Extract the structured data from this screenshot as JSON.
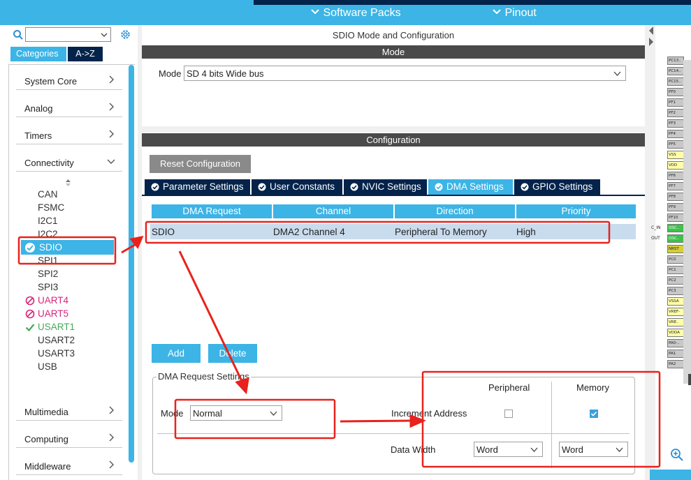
{
  "topbar": {
    "software_packs": "Software Packs",
    "pinout": "Pinout"
  },
  "left": {
    "tab_categories": "Categories",
    "tab_az": "A->Z",
    "categories": {
      "system_core": "System Core",
      "analog": "Analog",
      "timers": "Timers",
      "connectivity": "Connectivity",
      "multimedia": "Multimedia",
      "computing": "Computing",
      "middleware": "Middleware"
    },
    "peripherals": [
      {
        "label": "CAN",
        "status": "none"
      },
      {
        "label": "FSMC",
        "status": "none"
      },
      {
        "label": "I2C1",
        "status": "none"
      },
      {
        "label": "I2C2",
        "status": "none"
      },
      {
        "label": "SDIO",
        "status": "selected"
      },
      {
        "label": "SPI1",
        "status": "none"
      },
      {
        "label": "SPI2",
        "status": "none"
      },
      {
        "label": "SPI3",
        "status": "none"
      },
      {
        "label": "UART4",
        "status": "error"
      },
      {
        "label": "UART5",
        "status": "error"
      },
      {
        "label": "USART1",
        "status": "ok"
      },
      {
        "label": "USART2",
        "status": "none"
      },
      {
        "label": "USART3",
        "status": "none"
      },
      {
        "label": "USB",
        "status": "none"
      }
    ]
  },
  "center": {
    "title": "SDIO Mode and Configuration",
    "mode_bar": "Mode",
    "mode_label": "Mode",
    "mode_value": "SD 4 bits Wide bus",
    "config_bar": "Configuration",
    "reset_button": "Reset Configuration",
    "tabs": [
      "Parameter Settings",
      "User Constants",
      "NVIC Settings",
      "DMA Settings",
      "GPIO Settings"
    ],
    "active_tab": "DMA Settings",
    "table": {
      "headers": [
        "DMA Request",
        "Channel",
        "Direction",
        "Priority"
      ],
      "rows": [
        [
          "SDIO",
          "DMA2 Channel 4",
          "Peripheral To Memory",
          "High"
        ]
      ]
    },
    "add_button": "Add",
    "delete_button": "Delete",
    "dma_request_settings": {
      "title": "DMA Request Settings",
      "mode_label": "Mode",
      "mode_value": "Normal",
      "col_peripheral": "Peripheral",
      "col_memory": "Memory",
      "increment_address_label": "Increment Address",
      "increment_peripheral": false,
      "increment_memory": true,
      "data_width_label": "Data Width",
      "data_width_peripheral": "Word",
      "data_width_memory": "Word"
    }
  },
  "pins": {
    "labels": [
      "PC13..",
      "PC14..",
      "PC15..",
      "PF0",
      "PF1",
      "PF2",
      "PF3",
      "PF4",
      "PF5",
      "VSS",
      "VDD",
      "PF6",
      "PF7",
      "PF8",
      "PF9",
      "PF10",
      "OSC..",
      "OSC..",
      "NRST",
      "PC0",
      "PC1",
      "PC2",
      "PC3",
      "VSSA",
      "VREF-",
      "VRE..",
      "VDDA",
      "PA0-..",
      "PA1",
      "PA2"
    ],
    "side_labels": [
      "C_IN",
      "OUT"
    ]
  },
  "colors": {
    "accent": "#3cb4e6",
    "navy": "#03234b",
    "annotation_red": "#e8221c",
    "error_pink": "#d6247a",
    "ok_green": "#46a859"
  }
}
